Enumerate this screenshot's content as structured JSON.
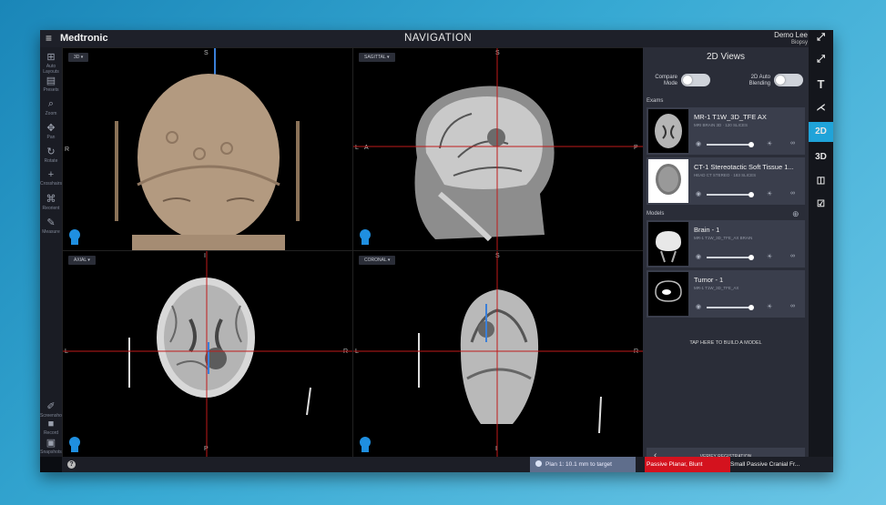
{
  "topbar": {
    "brand": "Medtronic",
    "title": "NAVIGATION",
    "user": "Demo Lee",
    "procedure": "Biopsy"
  },
  "left_tools": [
    {
      "icon": "move-icon",
      "label": "Auto Layouts"
    },
    {
      "icon": "layers-icon",
      "label": "Presets"
    },
    {
      "icon": "zoom-icon",
      "label": "Zoom"
    },
    {
      "icon": "pan-icon",
      "label": "Pan"
    },
    {
      "icon": "rotate-icon",
      "label": "Rotate"
    },
    {
      "icon": "crosshair-icon",
      "label": "Crosshairs"
    },
    {
      "icon": "reorient-icon",
      "label": "Reorient"
    },
    {
      "icon": "measure-icon",
      "label": "Measure"
    }
  ],
  "left_tools_bottom": [
    {
      "icon": "screenshot-icon",
      "label": "Screenshot"
    },
    {
      "icon": "record-icon",
      "label": "Record"
    },
    {
      "icon": "snapshots-icon",
      "label": "Snapshots"
    }
  ],
  "viewports": {
    "tl": {
      "dropdown": "3D",
      "top": "S",
      "left": "R"
    },
    "tr": {
      "dropdown": "SAGITTAL",
      "top": "S",
      "left": "L",
      "left2": "A",
      "right": "P"
    },
    "bl": {
      "dropdown": "AXIAL",
      "top": "I",
      "left": "L",
      "right": "R",
      "bottom": "P"
    },
    "br": {
      "dropdown": "CORONAL",
      "top": "S",
      "left": "L",
      "right": "R",
      "bottom": "I"
    }
  },
  "right_panel": {
    "title": "2D Views",
    "compare_mode": "Compare Mode",
    "auto_blending": "2D Auto Blending",
    "exams_label": "Exams",
    "exams": [
      {
        "name": "MR-1 T1W_3D_TFE AX",
        "sub": "MRI BRAIN 3D · 120 SLICES"
      },
      {
        "name": "CT-1 Stereotactic Soft Tissue 1...",
        "sub": "HEAD CT STEREO · 183 SLICES"
      }
    ],
    "models_label": "Models",
    "models": [
      {
        "name": "Brain - 1",
        "sub": "MR-1 T1W_3D_TFE_AX BRAIN"
      },
      {
        "name": "Tumor - 1",
        "sub": "MR-1 T1W_3D_TFE_AX"
      }
    ],
    "build_model": "TAP HERE TO BUILD A MODEL",
    "verify": "VERIFY REGISTRATION"
  },
  "far_right": [
    "2D",
    "3D"
  ],
  "bottom": {
    "help": "?",
    "target": "Plan 1: 10.1 mm to target",
    "tool1": "Passive Planar, Blunt",
    "tool2": "Small Passive Cranial Fr..."
  },
  "colors": {
    "accent": "#1fa3d9",
    "crosshair": "#c01a1a",
    "tool_active": "#d4121e"
  }
}
